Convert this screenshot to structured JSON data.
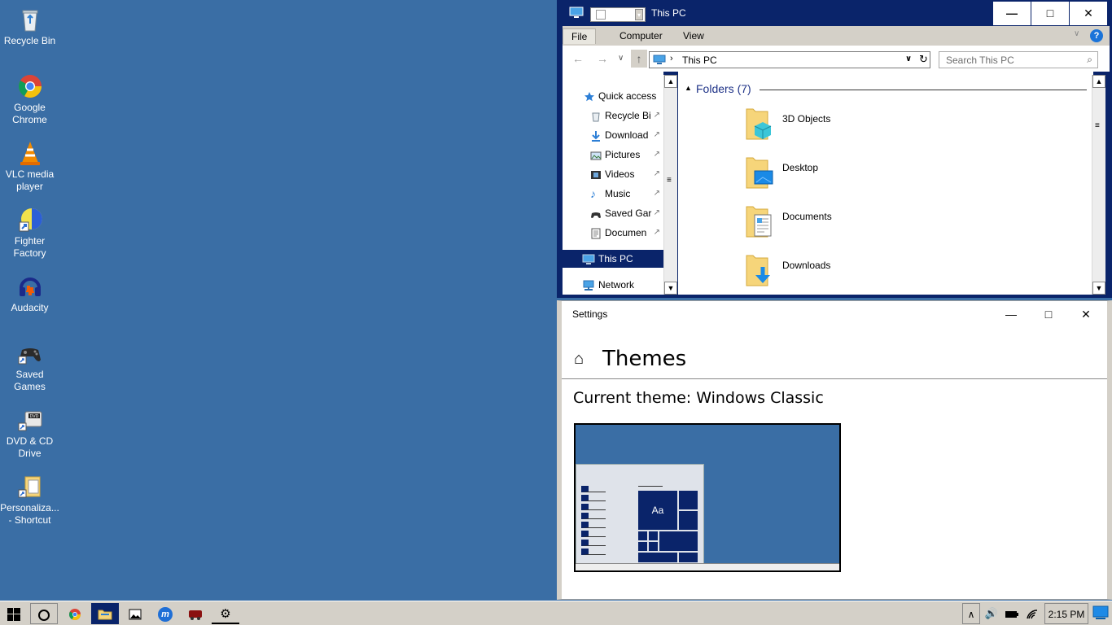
{
  "desktop": {
    "icons": [
      {
        "label": "Recycle Bin",
        "icon": "recycle-bin-icon"
      },
      {
        "label": "Google Chrome",
        "icon": "chrome-icon"
      },
      {
        "label": "VLC media player",
        "icon": "vlc-icon"
      },
      {
        "label": "Fighter Factory",
        "icon": "fighter-factory-icon"
      },
      {
        "label": "Audacity",
        "icon": "audacity-icon"
      },
      {
        "label": "Saved Games",
        "icon": "saved-games-icon"
      },
      {
        "label": "DVD & CD Drive",
        "icon": "dvd-drive-icon"
      },
      {
        "label": "Personaliza... - Shortcut",
        "icon": "shortcut-icon"
      }
    ]
  },
  "explorer": {
    "title": "This PC",
    "ribbon_tabs": [
      "File",
      "Computer",
      "View"
    ],
    "address_path": "This PC",
    "search_placeholder": "Search This PC",
    "nav_items": [
      {
        "label": "Quick access",
        "pinned": false,
        "level": 0
      },
      {
        "label": "Recycle Bi",
        "pinned": true,
        "level": 1
      },
      {
        "label": "Download",
        "pinned": true,
        "level": 1
      },
      {
        "label": "Pictures",
        "pinned": true,
        "level": 1
      },
      {
        "label": "Videos",
        "pinned": true,
        "level": 1
      },
      {
        "label": "Music",
        "pinned": true,
        "level": 1
      },
      {
        "label": "Saved Gar",
        "pinned": true,
        "level": 1
      },
      {
        "label": "Documen",
        "pinned": true,
        "level": 1
      },
      {
        "label": "This PC",
        "pinned": false,
        "level": 0,
        "selected": true
      },
      {
        "label": "Network",
        "pinned": false,
        "level": 0
      }
    ],
    "group_title": "Folders (7)",
    "folders": [
      "3D Objects",
      "Desktop",
      "Documents",
      "Downloads"
    ]
  },
  "settings": {
    "title": "Settings",
    "heading": "Themes",
    "current_theme": "Current theme: Windows Classic",
    "preview_sample": "Aa"
  },
  "taskbar": {
    "clock": "2:15 PM"
  },
  "colors": {
    "desktop": "#3a6ea5",
    "title_active": "#0a246a",
    "chrome": "#d4d0c8"
  }
}
